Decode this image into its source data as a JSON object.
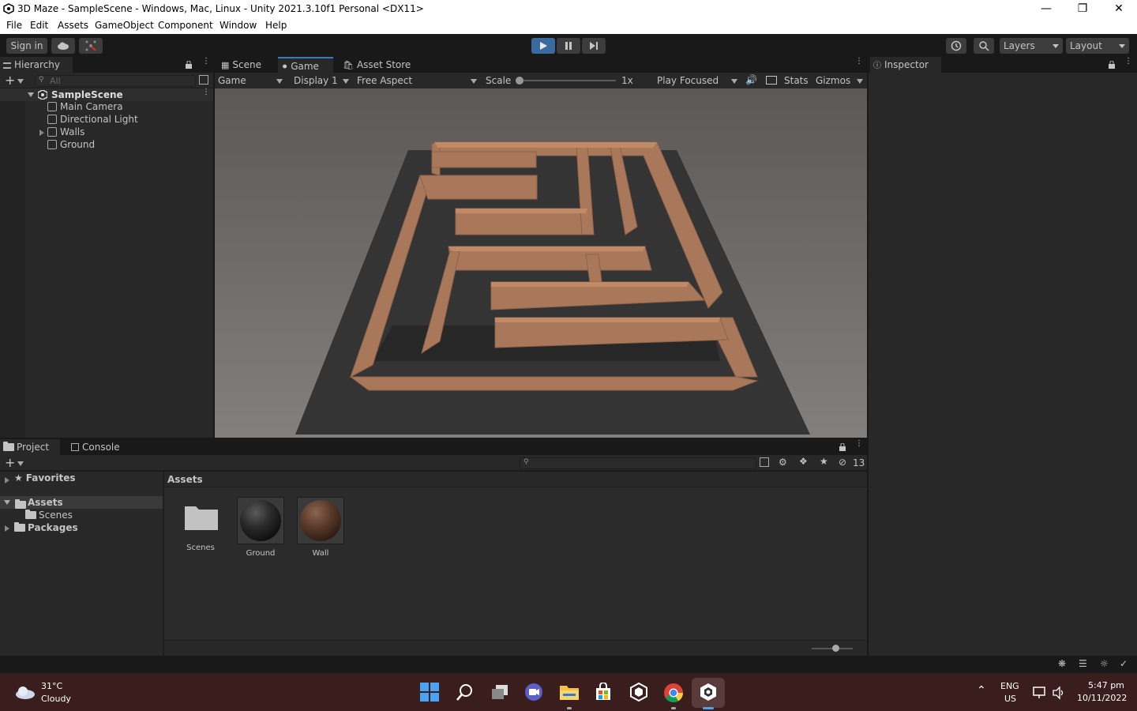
{
  "window": {
    "title": "3D Maze - SampleScene - Windows, Mac, Linux - Unity 2021.3.10f1 Personal <DX11>"
  },
  "menu": [
    "File",
    "Edit",
    "Assets",
    "GameObject",
    "Component",
    "Window",
    "Help"
  ],
  "toolbar": {
    "sign_in": "Sign in",
    "layers": "Layers",
    "layout": "Layout"
  },
  "hierarchy": {
    "tab": "Hierarchy",
    "search_placeholder": "All",
    "scene": "SampleScene",
    "items": [
      "Main Camera",
      "Directional Light",
      "Walls",
      "Ground"
    ]
  },
  "view_tabs": {
    "scene": "Scene",
    "game": "Game",
    "asset_store": "Asset Store"
  },
  "game_bar": {
    "display_mode": "Game",
    "display": "Display 1",
    "aspect": "Free Aspect",
    "scale_label": "Scale",
    "scale_value": "1x",
    "play_mode": "Play Focused",
    "stats": "Stats",
    "gizmos": "Gizmos"
  },
  "inspector": {
    "tab": "Inspector"
  },
  "bottom_tabs": {
    "project": "Project",
    "console": "Console"
  },
  "project": {
    "favorites": "Favorites",
    "assets": "Assets",
    "scenes": "Scenes",
    "packages": "Packages",
    "breadcrumb": "Assets",
    "hidden_count": "13",
    "items": [
      {
        "label": "Scenes",
        "kind": "folder"
      },
      {
        "label": "Ground",
        "kind": "material-dark"
      },
      {
        "label": "Wall",
        "kind": "material-brown"
      }
    ]
  },
  "taskbar": {
    "weather_temp": "31°C",
    "weather_desc": "Cloudy",
    "lang1": "ENG",
    "lang2": "US",
    "time": "5:47 pm",
    "date": "10/11/2022"
  },
  "colors": {
    "accent": "#3a79bb",
    "wall": "#a9785a",
    "ground": "#343434",
    "sky": "#6e6c6b"
  }
}
